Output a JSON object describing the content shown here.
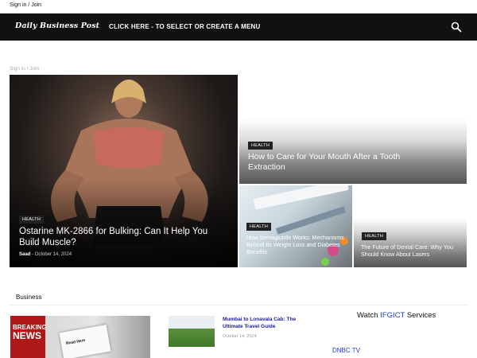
{
  "topbar": {
    "signin": "Sign in / Join"
  },
  "header": {
    "logo": "Daily Business Post",
    "menu_cta": "CLICK HERE - TO SELECT OR CREATE A MENU",
    "search_icon": "search-icon"
  },
  "breadcrumb": {
    "signin": "Sign in / Join"
  },
  "featured": [
    {
      "category": "HEALTH",
      "title": "Ostarine MK-2866 for Bulking: Can It Help You Build Muscle?",
      "author": "Saad",
      "separator": "-",
      "date": "October 14, 2024"
    },
    {
      "category": "HEALTH",
      "title": "How to Care for Your Mouth After a Tooth Extraction"
    },
    {
      "category": "HEALTH",
      "title": "How Semaglutide Works: Mechanisms Behind Its Weight Loss and Diabetes Benefits"
    },
    {
      "category": "HEALTH",
      "title": "The Future of Dental Care: Why You Should Know About Lasers"
    }
  ],
  "business": {
    "section_title": "Business",
    "image_text": {
      "breaking": "BREAKING",
      "news": "NEWS",
      "sheet": "Read Here"
    },
    "post": {
      "title": "Mumbai to Lonavala Cab: The Ultimate Travel Guide",
      "date": "October 14, 2024"
    }
  },
  "sidebar": {
    "watch_prefix": "Watch",
    "watch_brand": "IFGICT",
    "watch_suffix": "Services",
    "link": "DNBC TV"
  },
  "colors": {
    "navbar": "#111111",
    "link_blue": "#1a3fd6",
    "post_title_blue": "#1a1aa6",
    "badge": "#222222"
  }
}
